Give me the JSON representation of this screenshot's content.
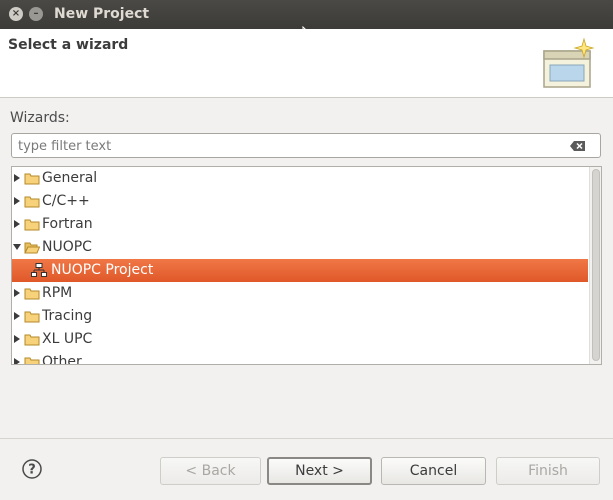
{
  "window": {
    "title": "New Project"
  },
  "header": {
    "title": "Select a wizard"
  },
  "wizards_label": "Wizards:",
  "filter": {
    "placeholder": "type filter text",
    "value": ""
  },
  "tree": {
    "items": [
      {
        "label": "General",
        "expanded": false,
        "icon": "folder-icon"
      },
      {
        "label": "C/C++",
        "expanded": false,
        "icon": "folder-icon"
      },
      {
        "label": "Fortran",
        "expanded": false,
        "icon": "folder-icon"
      },
      {
        "label": "NUOPC",
        "expanded": true,
        "icon": "folder-open-icon"
      },
      {
        "label": "NUOPC Project",
        "child": true,
        "selected": true,
        "icon": "project-hierarchy-icon"
      },
      {
        "label": "RPM",
        "expanded": false,
        "icon": "folder-icon"
      },
      {
        "label": "Tracing",
        "expanded": false,
        "icon": "folder-icon"
      },
      {
        "label": "XL UPC",
        "expanded": false,
        "icon": "folder-icon"
      },
      {
        "label": "Other",
        "expanded": false,
        "icon": "folder-icon"
      }
    ]
  },
  "buttons": {
    "back": "< Back",
    "next": "Next >",
    "cancel": "Cancel",
    "finish": "Finish"
  },
  "colors": {
    "selection": "#e9632f",
    "titlebar": "#3c3b37"
  }
}
